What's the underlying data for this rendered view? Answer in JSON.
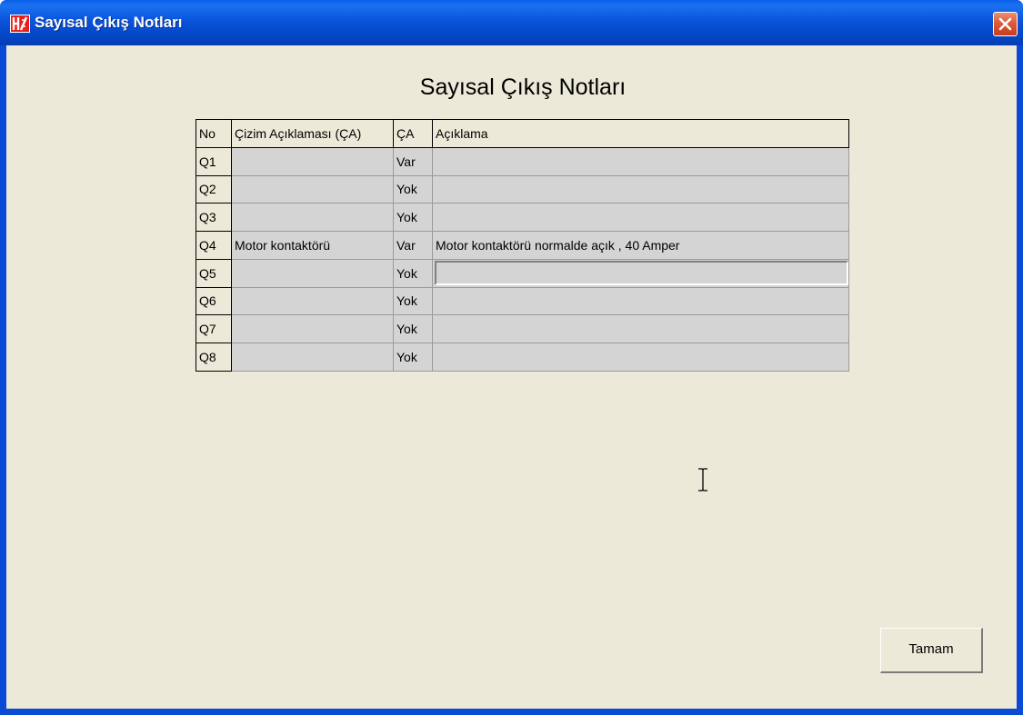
{
  "window": {
    "title": "Sayısal Çıkış Notları"
  },
  "heading": "Sayısal Çıkış Notları",
  "table": {
    "headers": [
      "No",
      "Çizim Açıklaması (ÇA)",
      "ÇA",
      "Açıklama"
    ],
    "rows": [
      {
        "no": "Q1",
        "drawing_desc": "",
        "ca": "Var",
        "desc": ""
      },
      {
        "no": "Q2",
        "drawing_desc": "",
        "ca": "Yok",
        "desc": ""
      },
      {
        "no": "Q3",
        "drawing_desc": "",
        "ca": "Yok",
        "desc": ""
      },
      {
        "no": "Q4",
        "drawing_desc": "Motor kontaktörü",
        "ca": "Var",
        "desc": "Motor kontaktörü normalde açık , 40 Amper"
      },
      {
        "no": "Q5",
        "drawing_desc": "",
        "ca": "Yok",
        "desc": ""
      },
      {
        "no": "Q6",
        "drawing_desc": "",
        "ca": "Yok",
        "desc": ""
      },
      {
        "no": "Q7",
        "drawing_desc": "",
        "ca": "Yok",
        "desc": ""
      },
      {
        "no": "Q8",
        "drawing_desc": "",
        "ca": "Yok",
        "desc": ""
      }
    ],
    "editing_row": 4
  },
  "buttons": {
    "ok_label": "Tamam"
  },
  "icons": {
    "app": "app-logo-icon",
    "close": "close-icon",
    "cursor": "text-cursor-icon"
  },
  "colors": {
    "titlebar": "#0a54dc",
    "client_bg": "#ece9d8",
    "cell_bg": "#d4d4d4",
    "close_button": "#df5b3a"
  }
}
